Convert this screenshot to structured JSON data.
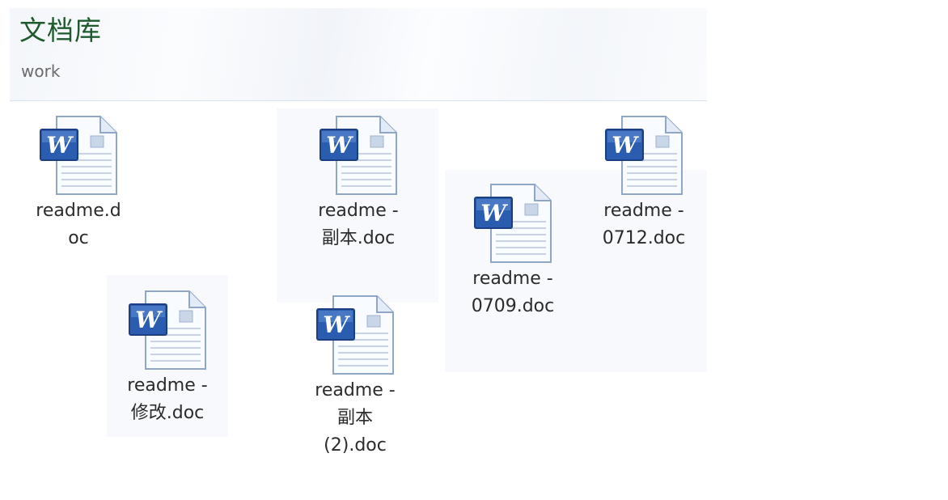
{
  "library": {
    "title": "文档库",
    "subtitle": "work"
  },
  "files": [
    {
      "id": "f1",
      "label": "readme.d\noc",
      "icon": "word-doc-icon"
    },
    {
      "id": "f2",
      "label": "readme -\n副本.doc",
      "icon": "word-doc-icon"
    },
    {
      "id": "f3",
      "label": "readme -\n0709.doc",
      "icon": "word-doc-icon"
    },
    {
      "id": "f4",
      "label": "readme -\n0712.doc",
      "icon": "word-doc-icon"
    },
    {
      "id": "f5",
      "label": "readme -\n修改.doc",
      "icon": "word-doc-icon"
    },
    {
      "id": "f6",
      "label": "readme -\n副本\n(2).doc",
      "icon": "word-doc-icon"
    }
  ],
  "colors": {
    "title": "#1e5a2c",
    "subtitle": "#6b6b6b",
    "word_blue": "#2a5db0",
    "page_edge": "#8fa6c8"
  }
}
